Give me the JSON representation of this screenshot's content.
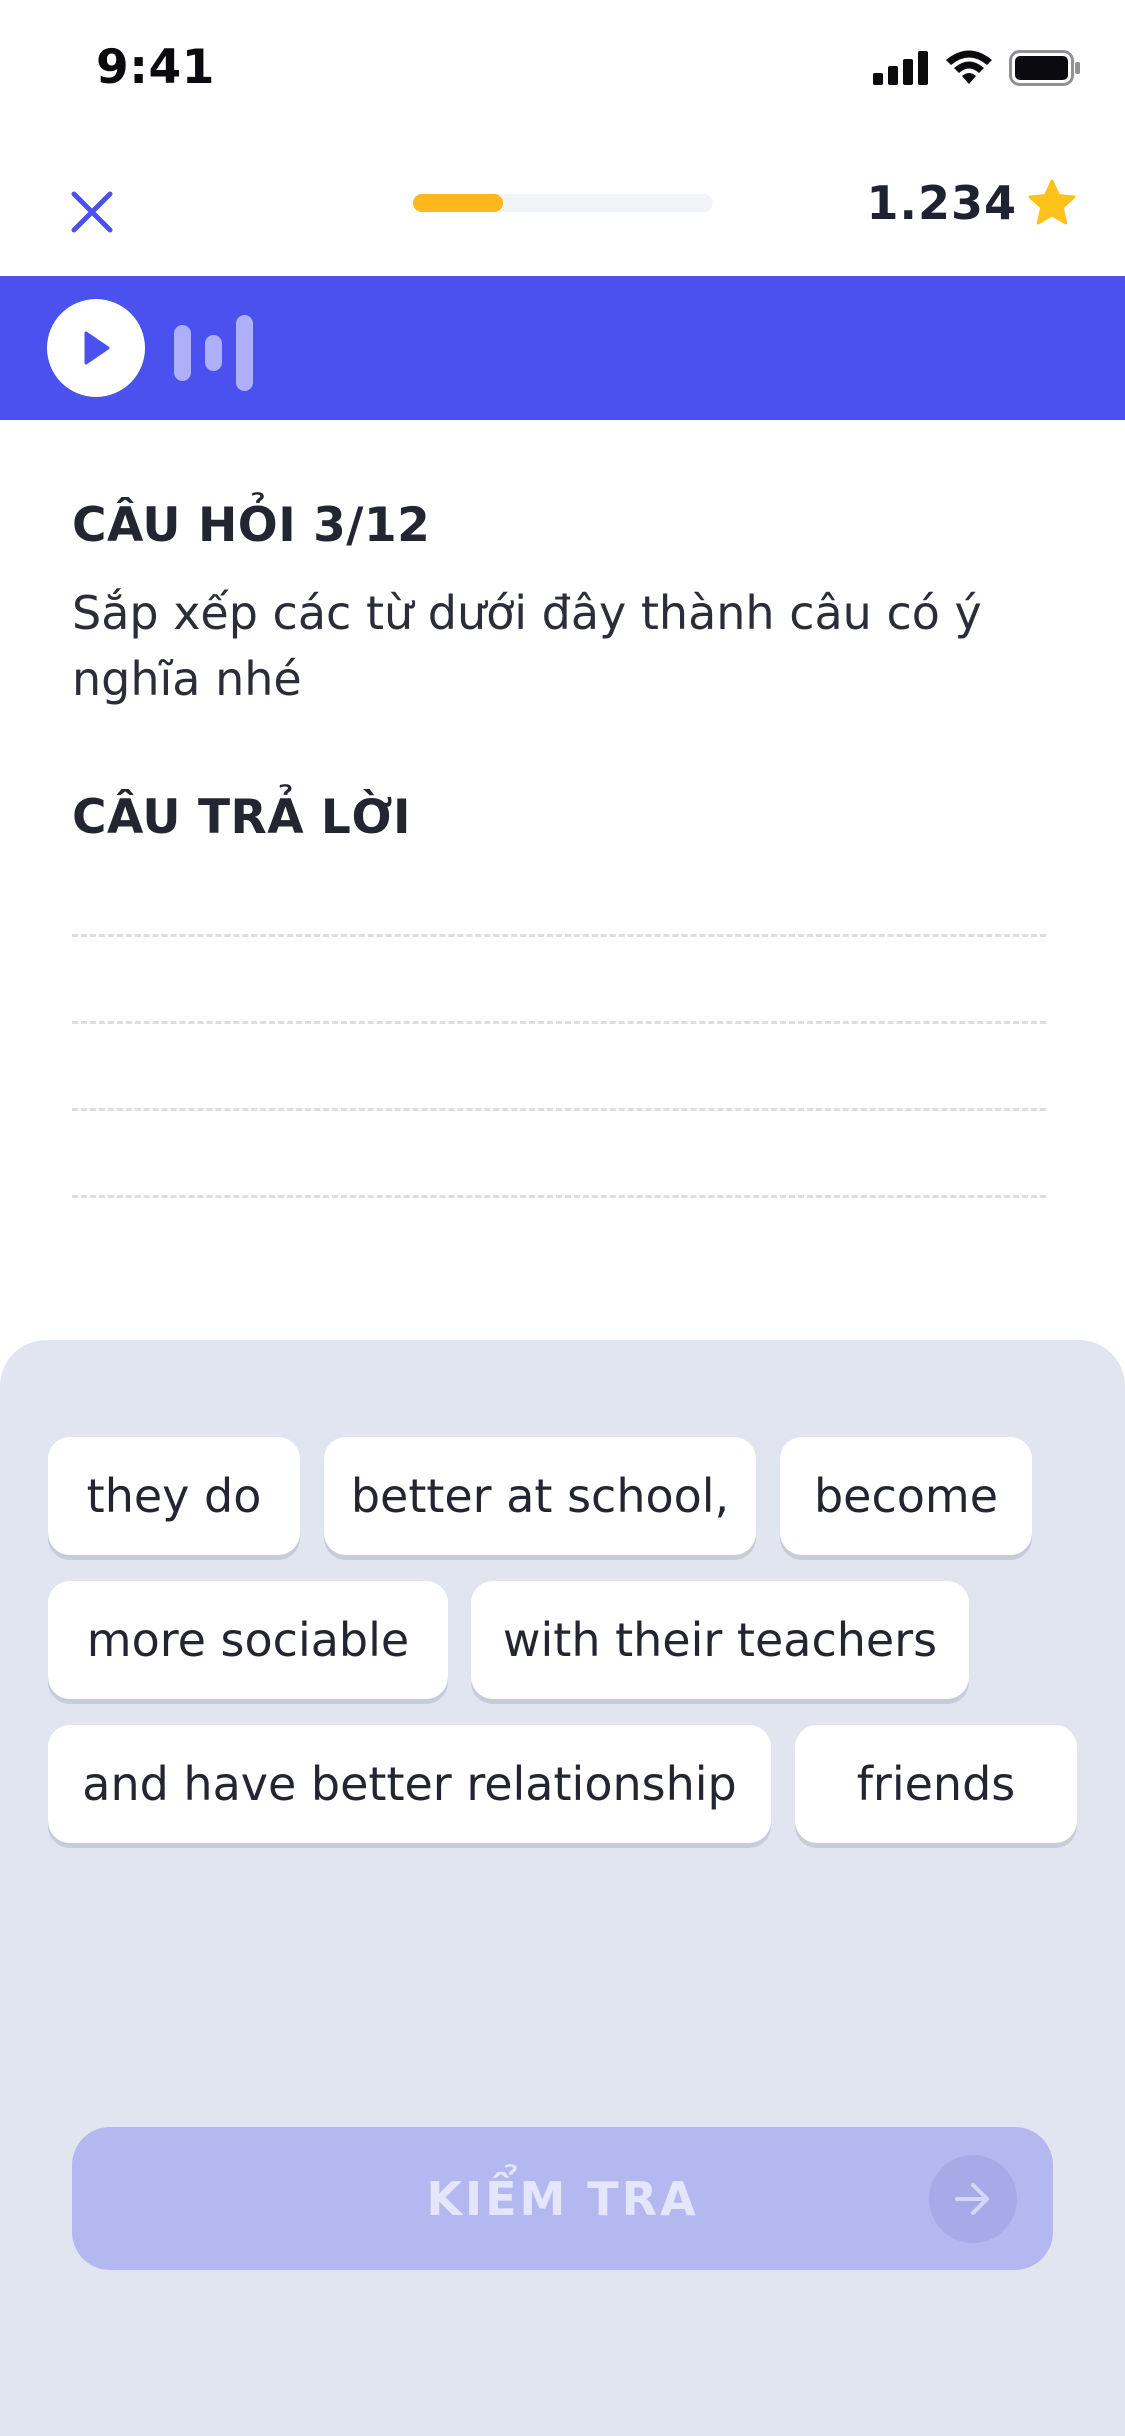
{
  "status_bar": {
    "time": "9:41",
    "icons": [
      "signal-icon",
      "wifi-icon",
      "battery-icon"
    ]
  },
  "header": {
    "close_icon": "close-icon",
    "progress": 0.3,
    "score": "1.234",
    "score_icon": "star-icon"
  },
  "audio": {
    "play_icon": "play-icon",
    "wave_icon": "audio-wave-icon"
  },
  "question": {
    "label": "CÂU HỎI 3/12",
    "text": "Sắp xếp các từ dưới đây thành câu có ý nghĩa nhé"
  },
  "answer": {
    "label": "CÂU TRẢ LỜI",
    "line_count": 4
  },
  "word_bank": {
    "chips": [
      "they do",
      "better at school,",
      "become",
      "more sociable",
      "with their teachers",
      "and have better relationship",
      "friends"
    ]
  },
  "footer": {
    "check_label": "KIỂM TRA",
    "check_icon": "arrow-right-icon"
  },
  "colors": {
    "accent": "#4a51ef",
    "progress": "#ffb71b",
    "star": "#ffc21a",
    "word_bank_bg": "#e1e5ef",
    "check_button_disabled": "#b3b8f0"
  }
}
